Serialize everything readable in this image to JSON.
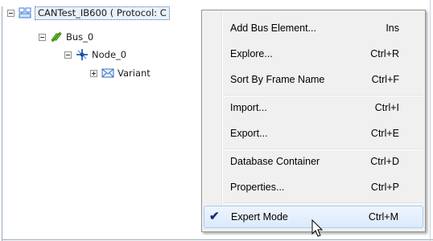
{
  "tree": {
    "root_label": "CANTest_IB600 ( Protocol: C",
    "bus_label": "Bus_0",
    "node_label": "Node_0",
    "variant_label": "Variant",
    "root_icon": "database-icon",
    "bus_icon": "bus-icon",
    "node_icon": "node-icon",
    "variant_icon": "envelope-icon"
  },
  "context_menu": {
    "items": [
      {
        "label": "Add Bus Element...",
        "shortcut": "Ins"
      },
      {
        "label": "Explore...",
        "shortcut": "Ctrl+R"
      },
      {
        "label": "Sort By Frame Name",
        "shortcut": "Ctrl+F"
      },
      {
        "label": "Import...",
        "shortcut": "Ctrl+I"
      },
      {
        "label": "Export...",
        "shortcut": "Ctrl+E"
      },
      {
        "label": "Database Container",
        "shortcut": "Ctrl+D"
      },
      {
        "label": "Properties...",
        "shortcut": "Ctrl+P"
      },
      {
        "label": "Expert Mode",
        "shortcut": "Ctrl+M",
        "checked": true,
        "check_glyph": "✔"
      }
    ]
  },
  "colors": {
    "menu_background": "#f0f0f0",
    "highlight_border": "#a8cdf2",
    "selection_background": "#e9f1fb",
    "check_color": "#1b2e7a"
  }
}
